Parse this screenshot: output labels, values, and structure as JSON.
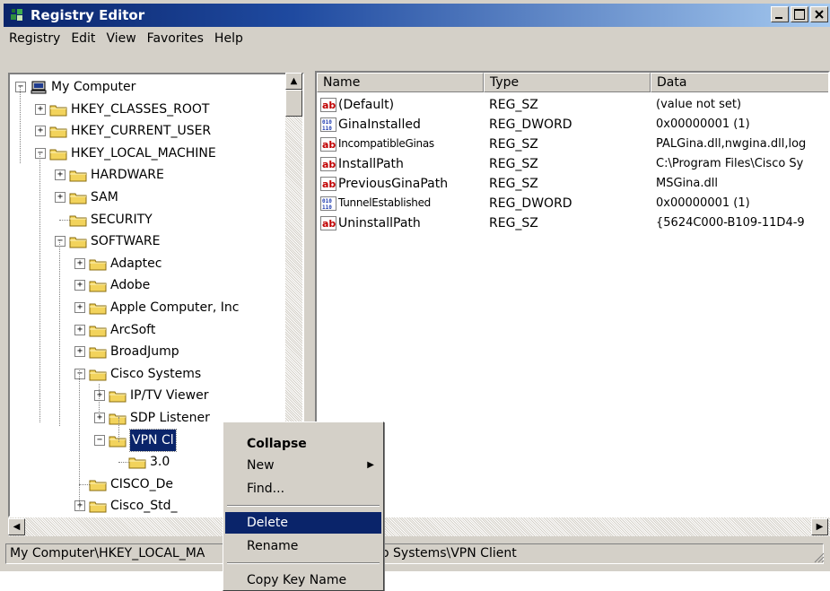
{
  "window": {
    "title": "Registry Editor",
    "controls": [
      "_",
      "□",
      "×"
    ]
  },
  "menubar": {
    "items": [
      "Registry",
      "Edit",
      "View",
      "Favorites",
      "Help"
    ]
  },
  "tree": {
    "items": [
      {
        "label": "My Computer",
        "expander": "−"
      },
      {
        "label": "HKEY_CLASSES_ROOT",
        "expander": "+"
      },
      {
        "label": "HKEY_CURRENT_USER",
        "expander": "+"
      },
      {
        "label": "HKEY_LOCAL_MACHINE",
        "expander": "−"
      },
      {
        "label": "HARDWARE",
        "expander": "+"
      },
      {
        "label": "SAM",
        "expander": "+"
      },
      {
        "label": "SECURITY",
        "expander": ""
      },
      {
        "label": "SOFTWARE",
        "expander": "−"
      },
      {
        "label": "Adaptec",
        "expander": "+"
      },
      {
        "label": "Adobe",
        "expander": "+"
      },
      {
        "label": "Apple Computer, Inc",
        "expander": "+"
      },
      {
        "label": "ArcSoft",
        "expander": "+"
      },
      {
        "label": "BroadJump",
        "expander": "+"
      },
      {
        "label": "Cisco Systems",
        "expander": "−"
      },
      {
        "label": "IP/TV Viewer",
        "expander": "+"
      },
      {
        "label": "SDP Listener",
        "expander": "+"
      },
      {
        "label": "VPN Cl",
        "expander": "−"
      },
      {
        "label": "3.0",
        "expander": ""
      },
      {
        "label": "CISCO_De",
        "expander": ""
      },
      {
        "label": "Cisco_Std_",
        "expander": "+"
      }
    ]
  },
  "list": {
    "columns": [
      "Name",
      "Type",
      "Data"
    ],
    "rows": [
      {
        "icon": "ab",
        "name": "(Default)",
        "type": "REG_SZ",
        "data": "(value not set)"
      },
      {
        "icon": "bin",
        "name": "GinaInstalled",
        "type": "REG_DWORD",
        "data": "0x00000001 (1)"
      },
      {
        "icon": "ab",
        "name": "IncompatibleGinas",
        "type": "REG_SZ",
        "data": "PALGina.dll,nwgina.dll,log"
      },
      {
        "icon": "ab",
        "name": "InstallPath",
        "type": "REG_SZ",
        "data": "C:\\Program Files\\Cisco Sy"
      },
      {
        "icon": "ab",
        "name": "PreviousGinaPath",
        "type": "REG_SZ",
        "data": "MSGina.dll"
      },
      {
        "icon": "bin",
        "name": "TunnelEstablished",
        "type": "REG_DWORD",
        "data": "0x00000001 (1)"
      },
      {
        "icon": "ab",
        "name": "UninstallPath",
        "type": "REG_SZ",
        "data": "{5624C000-B109-11D4-9"
      }
    ]
  },
  "statusbar": {
    "left": "My Computer\\HKEY_LOCAL_MA",
    "right": "o Systems\\VPN Client"
  },
  "context_menu": {
    "items": [
      "Collapse",
      "New",
      "Find...",
      "Delete",
      "Rename",
      "Copy Key Name"
    ],
    "submenu_arrow": "▶"
  },
  "colors": {
    "face": "#d4d0c8",
    "selection": "#0a246a",
    "title_gradient_start": "#0a246a",
    "title_gradient_end": "#a6caf0",
    "string_icon": "#c00000",
    "binary_icon": "#1f3cb0",
    "folder": "#f2d35c"
  }
}
